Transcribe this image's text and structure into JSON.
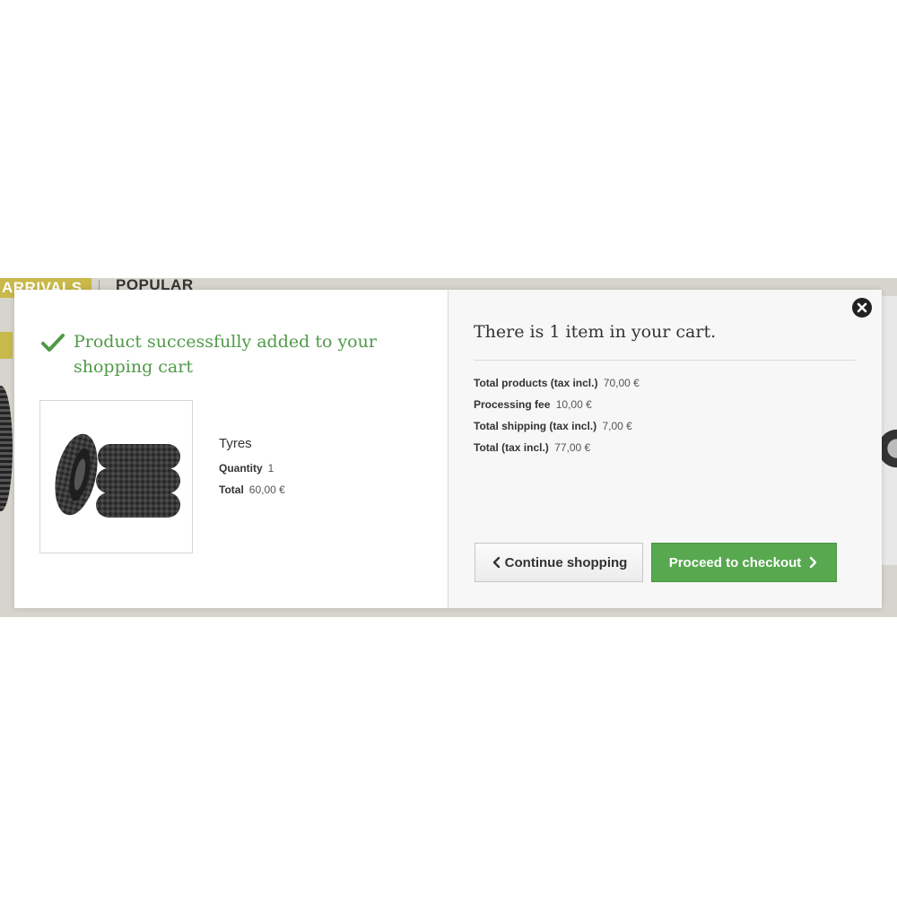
{
  "background": {
    "tab_arrivals": "ARRIVALS",
    "tab_popular": "POPULAR"
  },
  "modal": {
    "success_message": "Product successfully added to your shopping cart",
    "product": {
      "name": "Tyres",
      "quantity_label": "Quantity",
      "quantity_value": "1",
      "total_label": "Total",
      "total_value": "60,00 €"
    },
    "cart": {
      "heading": "There is 1 item in your cart.",
      "summary": [
        {
          "label": "Total products (tax incl.)",
          "value": "70,00 €"
        },
        {
          "label": "Processing fee",
          "value": "10,00 €"
        },
        {
          "label": "Total shipping (tax incl.)",
          "value": "7,00 €"
        },
        {
          "label": "Total (tax incl.)",
          "value": "77,00 €"
        }
      ]
    },
    "buttons": {
      "continue": "Continue shopping",
      "checkout": "Proceed to checkout"
    }
  },
  "colors": {
    "success_green": "#4f9a47",
    "checkout_green": "#57a84f",
    "tab_gold": "#c9b84a"
  },
  "icons": [
    "check-icon",
    "close-icon",
    "chevron-left-icon",
    "chevron-right-icon",
    "tyres-image"
  ]
}
